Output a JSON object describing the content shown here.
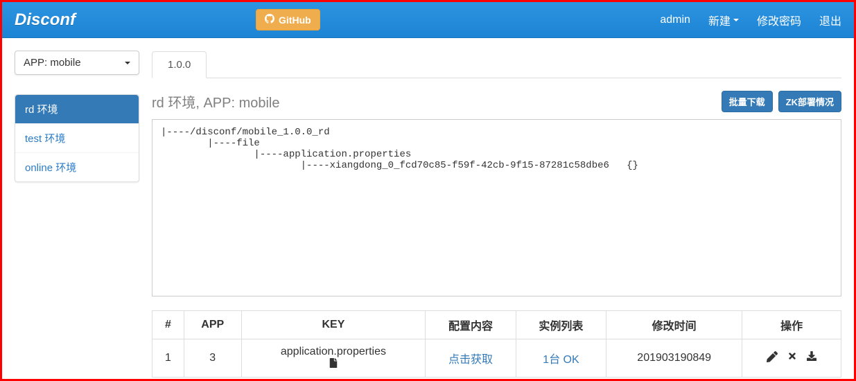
{
  "navbar": {
    "brand": "Disconf",
    "github": "GitHub",
    "admin": "admin",
    "new": "新建",
    "change_pw": "修改密码",
    "logout": "退出"
  },
  "sidebar": {
    "app_selector": "APP: mobile",
    "envs": [
      "rd 环境",
      "test 环境",
      "online 环境"
    ],
    "active_index": 0
  },
  "main": {
    "tab_label": "1.0.0",
    "heading": "rd 环境, APP: mobile",
    "btn_download": "批量下载",
    "btn_zk": "ZK部署情况",
    "tree": "|----/disconf/mobile_1.0.0_rd\n\t|----file\n\t\t|----application.properties\n\t\t\t|----xiangdong_0_fcd70c85-f59f-42cb-9f15-87281c58dbe6   {}"
  },
  "table": {
    "headers": [
      "#",
      "APP",
      "KEY",
      "配置内容",
      "实例列表",
      "修改时间",
      "操作"
    ],
    "row": {
      "index": "1",
      "app": "3",
      "key": "application.properties",
      "content": "点击获取",
      "instances": "1台 OK",
      "mtime": "201903190849"
    }
  }
}
